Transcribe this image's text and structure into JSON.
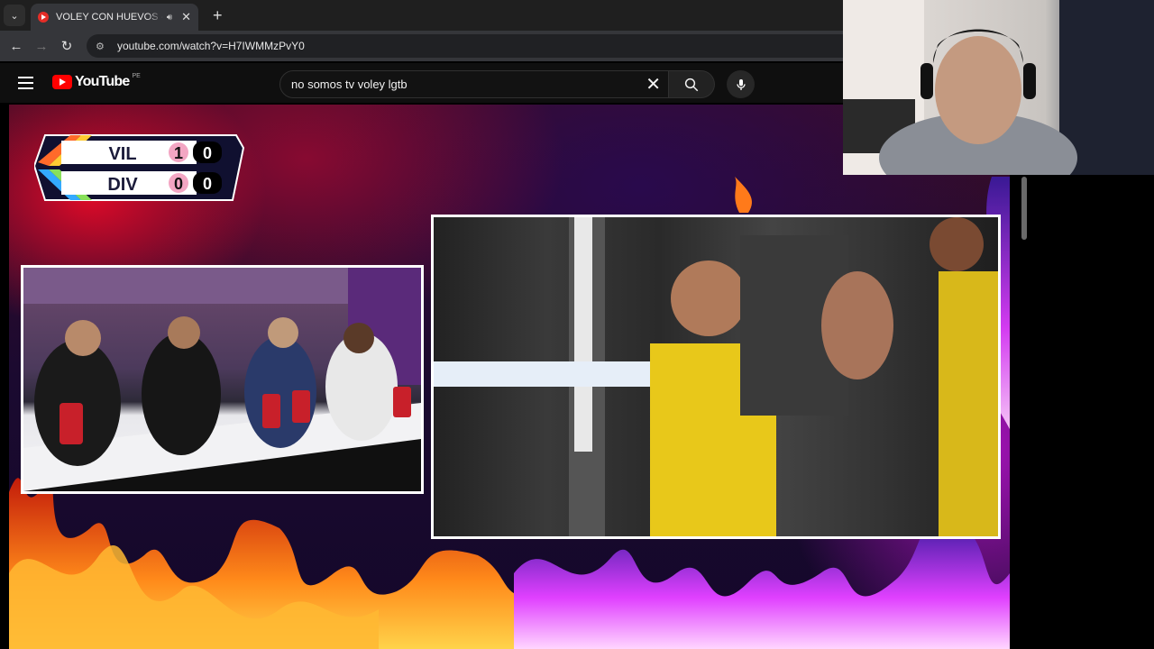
{
  "browser": {
    "tab": {
      "title": "VOLEY CON HUEVOS - JOGO",
      "icon": "youtube-favicon",
      "audio_icon": "speaker-icon"
    },
    "url": "youtube.com/watch?v=H7IWMMzPvY0",
    "new_tab_label": "+"
  },
  "youtube": {
    "logo_text": "YouTube",
    "country_code": "PE",
    "search_query": "no somos tv voley lgtb"
  },
  "scoreboard": {
    "teams": [
      {
        "name": "VIL",
        "sets": "1",
        "points": "0"
      },
      {
        "name": "DIV",
        "sets": "0",
        "points": "0"
      }
    ]
  },
  "colors": {
    "youtube_red": "#ff0000",
    "chrome_dark": "#1f1f1f",
    "toolbar": "#35363a"
  }
}
